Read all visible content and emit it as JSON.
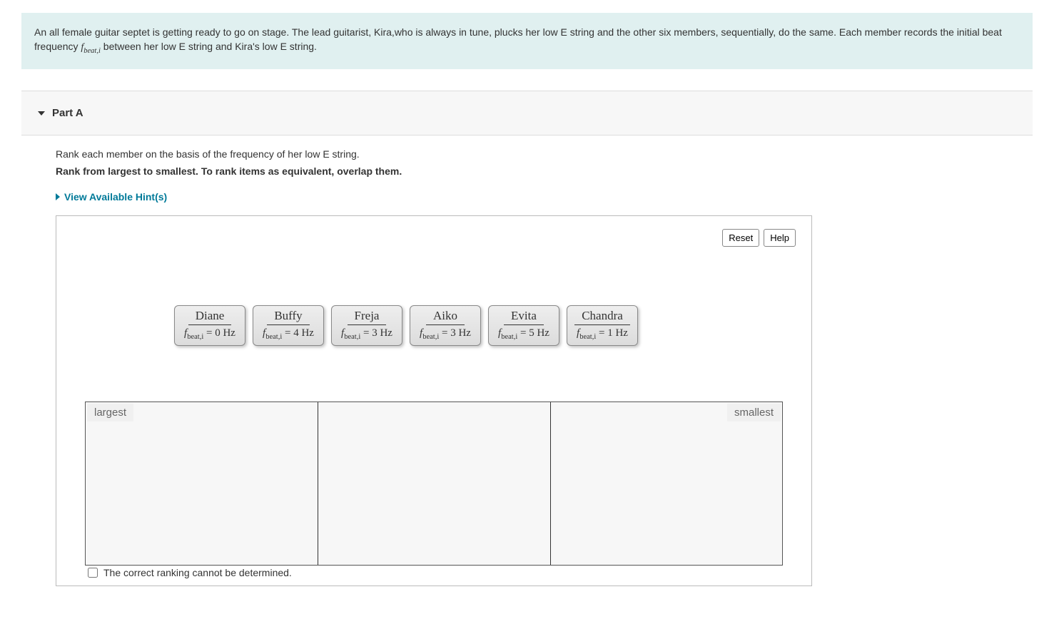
{
  "intro": {
    "text_before": "An all female guitar septet is getting ready to go on stage. The lead guitarist, Kira,who is always in tune, plucks her low E string and the other six members, sequentially, do the same. Each member records the initial beat frequency ",
    "fbeat_symbol": "f",
    "fbeat_sub": "beat,i",
    "text_after": " between her low E string and Kira's low E string."
  },
  "part": {
    "label": "Part A",
    "instruction1": "Rank each member on the basis of the frequency of her low E string.",
    "instruction2": "Rank from largest to smallest. To rank items as equivalent, overlap them.",
    "hints_label": "View Available Hint(s)"
  },
  "widget": {
    "reset_label": "Reset",
    "help_label": "Help",
    "largest_label": "largest",
    "smallest_label": "smallest",
    "cannot_determine_label": "The correct ranking cannot be determined.",
    "freq_symbol": "f",
    "freq_sub": "beat,i",
    "items": [
      {
        "name": "Diane",
        "value": "= 0 Hz"
      },
      {
        "name": "Buffy",
        "value": "= 4 Hz"
      },
      {
        "name": "Freja",
        "value": "= 3 Hz"
      },
      {
        "name": "Aiko",
        "value": "= 3 Hz"
      },
      {
        "name": "Evita",
        "value": "= 5 Hz"
      },
      {
        "name": "Chandra",
        "value": "= 1 Hz"
      }
    ]
  }
}
